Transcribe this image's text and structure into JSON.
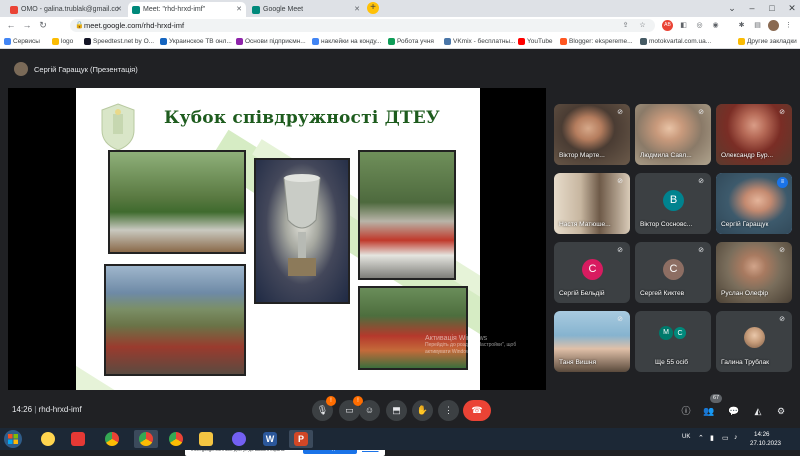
{
  "browser": {
    "tabs": [
      {
        "title": "ОМО - galina.trublak@gmail.co",
        "active": false,
        "favicon_color": "#ea4335"
      },
      {
        "title": "Meet: \"rhd-hrxd-imf\"",
        "active": true,
        "favicon_color": "#00897b"
      },
      {
        "title": "Google Meet",
        "active": false,
        "favicon_color": "#00897b"
      }
    ],
    "new_tab": "+",
    "url": "meet.google.com/rhd-hrxd-imf",
    "bookmarks": [
      "Сервисы",
      "logo",
      "Speedtest.net by O...",
      "Украинское ТВ онл...",
      "Основи підприємн...",
      "наклейки на конду...",
      "Робота учня",
      "VKmix - бесплатны...",
      "YouTube",
      "Blogger: eksperеme...",
      "motokvartal.com.ua...",
      "Другие закладки"
    ]
  },
  "meet": {
    "presenter_label": "Сергій Гаращук (Презентація)",
    "slide": {
      "title": "Кубок співдружності ДТЕУ"
    },
    "toast": {
      "text": "meet.google.com має доступ до вашого екрана.",
      "stop_label": "Більше не ділитися",
      "hide_label": "Сховати"
    },
    "watermark": {
      "line1": "Активація Windows",
      "line2": "Перейдіть до розділу \"Настройки\", щоб",
      "line3": "активувати Windows."
    },
    "participants": [
      {
        "name": "Віктор Марте...",
        "type": "photo",
        "muted": true,
        "color": "#6b5a4a"
      },
      {
        "name": "Людмила Савл...",
        "type": "photo",
        "muted": true,
        "color": "#8a7a68"
      },
      {
        "name": "Олександр Бур...",
        "type": "photo",
        "muted": true,
        "color": "#5a3b2e"
      },
      {
        "name": "Настя Матюше...",
        "type": "photo",
        "muted": true,
        "color": "#c7b6a0"
      },
      {
        "name": "Віктор Сосновс...",
        "type": "avatar",
        "initial": "В",
        "avatar_color": "#00838f",
        "muted": true
      },
      {
        "name": "Сергій Гаращук",
        "type": "photo",
        "muted": false,
        "speaking": true,
        "color": "#3d5a6c"
      },
      {
        "name": "Сергій Бельдій",
        "type": "avatar",
        "initial": "С",
        "avatar_color": "#d81b60",
        "muted": true
      },
      {
        "name": "Сергей Киктев",
        "type": "avatar",
        "initial": "С",
        "avatar_color": "#8d6e63",
        "muted": true
      },
      {
        "name": "Руслан Олефір",
        "type": "photo",
        "muted": true,
        "color": "#7a6e5c"
      },
      {
        "name": "Таня Вишня",
        "type": "photo",
        "muted": true,
        "color": "#86b3cf"
      },
      {
        "name": "Ще 55 осіб",
        "type": "more",
        "muted": false
      },
      {
        "name": "Галина Трублак",
        "type": "avatar-photo",
        "muted": true,
        "avatar_color": "#c69c7a"
      }
    ],
    "more_initials": [
      "М",
      "С"
    ],
    "meeting_code": "rhd-hrxd-imf",
    "time": "14:26",
    "people_count": "67",
    "mic_notif": "!",
    "cam_notif": "!"
  },
  "taskbar": {
    "language": "UK",
    "time": "14:26",
    "date": "27.10.2023"
  }
}
